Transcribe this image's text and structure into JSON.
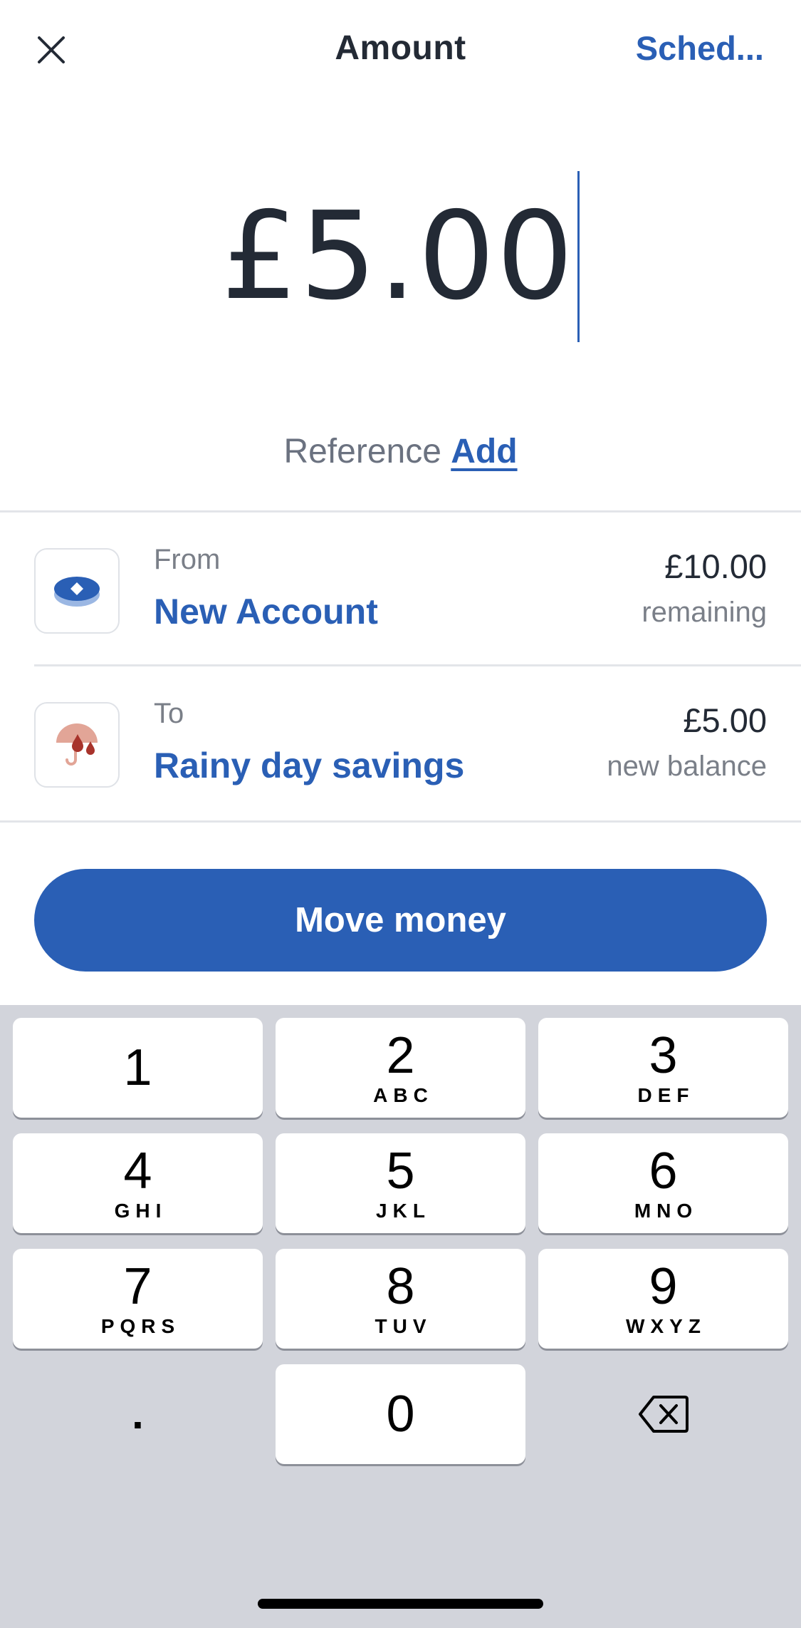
{
  "nav": {
    "close_icon": "close-icon",
    "title": "Amount",
    "schedule_label": "Sched..."
  },
  "amount": {
    "value": "£5.00"
  },
  "reference": {
    "label": "Reference",
    "add_label": "Add"
  },
  "from": {
    "caption": "From",
    "name": "New Account",
    "amount": "£10.00",
    "subtext": "remaining",
    "icon": "account-disc-icon"
  },
  "to": {
    "caption": "To",
    "name": "Rainy day savings",
    "amount": "£5.00",
    "subtext": "new balance",
    "icon": "umbrella-icon"
  },
  "action": {
    "move_label": "Move money"
  },
  "keypad": {
    "keys": [
      {
        "digit": "1",
        "letters": ""
      },
      {
        "digit": "2",
        "letters": "ABC"
      },
      {
        "digit": "3",
        "letters": "DEF"
      },
      {
        "digit": "4",
        "letters": "GHI"
      },
      {
        "digit": "5",
        "letters": "JKL"
      },
      {
        "digit": "6",
        "letters": "MNO"
      },
      {
        "digit": "7",
        "letters": "PQRS"
      },
      {
        "digit": "8",
        "letters": "TUV"
      },
      {
        "digit": "9",
        "letters": "WXYZ"
      },
      {
        "digit": "0",
        "letters": ""
      }
    ],
    "decimal": ".",
    "delete_icon": "backspace-icon"
  },
  "colors": {
    "accent": "#2a5fb5",
    "text": "#232a35",
    "muted": "#7a7f88",
    "keypad_bg": "#d2d4db"
  }
}
